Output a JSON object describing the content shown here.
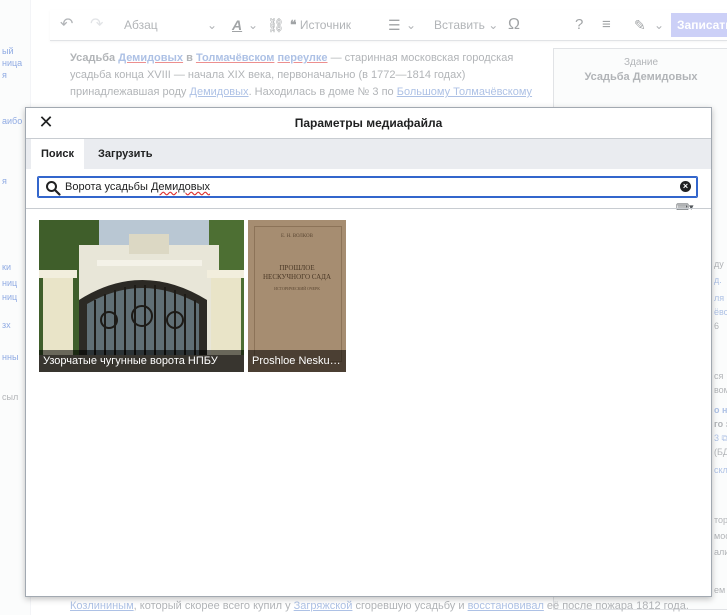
{
  "sidebar": {
    "fragments": [
      "ый",
      "ница",
      "я",
      "аибо",
      "я",
      "ки",
      "ниц",
      "ниц",
      "зх",
      "нны",
      "сыл"
    ]
  },
  "toolbar": {
    "undo_icon": "undo-icon",
    "redo_icon": "redo-icon",
    "paragraph_label": "Абзац",
    "text_style_label": "A",
    "link_icon": "link-icon",
    "cite_label": "Источник",
    "list_icon": "list-icon",
    "insert_label": "Вставить",
    "special_char_label": "Ω",
    "help_label": "?",
    "save_label": "Записать"
  },
  "article": {
    "line1_bold1": "Усадьба ",
    "line1_link1": "Демидовых",
    "line1_bold2": " в ",
    "line1_link2": "Толмачёвском",
    "line1_bold3": " ",
    "line1_link3": "переулке",
    "line1_rest": " — старинная московская городская",
    "line2": "усадьба конца XVIII — начала XIX века, первоначально (в 1772—1814 годах)",
    "line3_a": "принадлежавшая роду ",
    "line3_link": "Демидовых",
    "line3_b": ". Находилась в доме № 3 по ",
    "line3_link2": "Большому Толмачёвскому"
  },
  "infobox": {
    "label": "Здание",
    "title": "Усадьба Демидовых",
    "fragments": [
      "ду",
      "д.",
      "ля",
      "ёвск",
      "6",
      "ся",
      "вом",
      "о на",
      "го з",
      "3 ⧉ ,",
      "(БД",
      "скла",
      "тор",
      "мос",
      "али",
      "ем"
    ]
  },
  "bottom": {
    "link1": "Козлининым",
    "text1": ", который скорее всего купил у ",
    "link2": "Загряжской",
    "text2": " сгоревшую усадьбу и ",
    "link3": "восстановивал",
    "text3": " её после пожара 1812 года."
  },
  "dialog": {
    "title": "Параметры медиафайла",
    "tabs": [
      "Поиск",
      "Загрузить"
    ],
    "search": {
      "value_prefix": "Ворота усадьбы ",
      "value_spell": "Демидовых"
    },
    "results": [
      {
        "caption": "Узорчатые чугунные ворота НПБУ"
      },
      {
        "caption": "Proshloe Nesku…"
      }
    ],
    "book_cover": {
      "author": "Е. Н. ВОЛКОВ",
      "title_line1": "ПРОШЛОЕ",
      "title_line2": "НЕСКУЧНОГО САДА",
      "subtitle": "ИСТОРИЧЕСКИЙ ОЧЕРК"
    }
  },
  "colors": {
    "accent": "#3366cc",
    "save_button": "#a2a9f0",
    "dialog_border": "#a2a9b1"
  }
}
